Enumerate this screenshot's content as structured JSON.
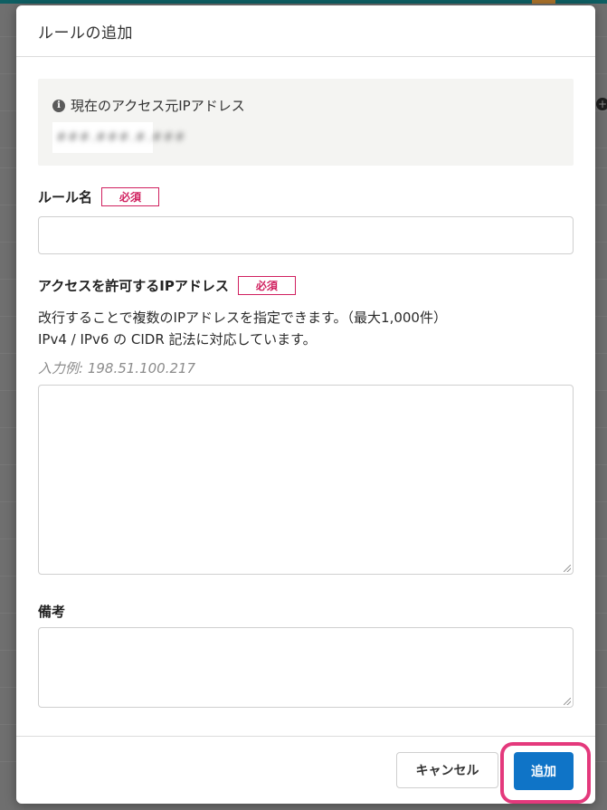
{
  "modal": {
    "title": "ルールの追加"
  },
  "current_ip": {
    "label": "現在のアクセス元IPアドレス",
    "value": "###.###.#.###"
  },
  "rule_name": {
    "label": "ルール名",
    "required_badge": "必須",
    "value": ""
  },
  "allowed_ips": {
    "label": "アクセスを許可するIPアドレス",
    "required_badge": "必須",
    "help_line1": "改行することで複数のIPアドレスを指定できます。（最大1,000件）",
    "help_line2": "IPv4 / IPv6 の CIDR 記法に対応しています。",
    "example": "入力例: 198.51.100.217",
    "value": ""
  },
  "notes": {
    "label": "備考",
    "value": ""
  },
  "footer": {
    "cancel_label": "キャンセル",
    "add_label": "追加"
  },
  "colors": {
    "primary": "#0f74c7",
    "required": "#d0205f",
    "highlight": "#e4397c"
  },
  "icons": {
    "info": "info-icon"
  }
}
